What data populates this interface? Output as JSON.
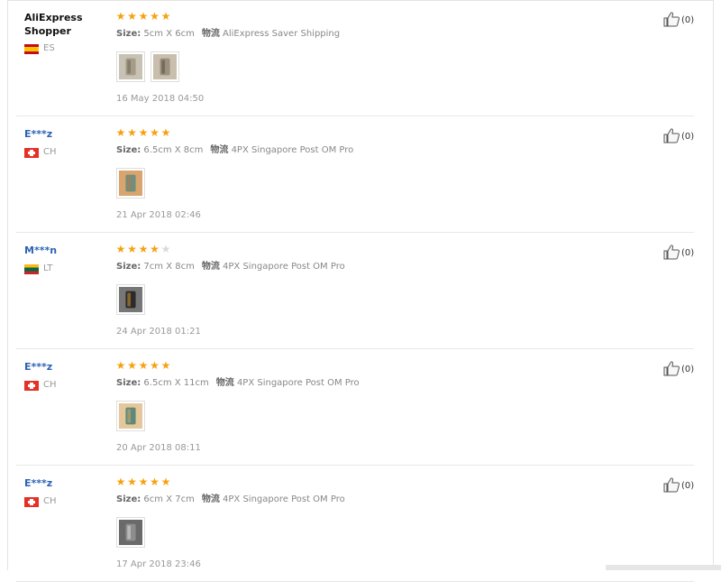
{
  "reviews": [
    {
      "buyer": "AliExpress Shopper",
      "country_code": "ES",
      "rating": 5,
      "size_label": "Size:",
      "size_value": "5cm X 6cm",
      "logistics_label": "物流",
      "logistics_value": "AliExpress Saver Shipping",
      "photo_count": 2,
      "date": "16 May 2018 04:50",
      "helpful_count": "(0)"
    },
    {
      "buyer": "E***z",
      "country_code": "CH",
      "rating": 5,
      "size_label": "Size:",
      "size_value": "6.5cm X 8cm",
      "logistics_label": "物流",
      "logistics_value": "4PX Singapore Post OM Pro",
      "photo_count": 1,
      "date": "21 Apr 2018 02:46",
      "helpful_count": "(0)"
    },
    {
      "buyer": "M***n",
      "country_code": "LT",
      "rating": 4,
      "size_label": "Size:",
      "size_value": "7cm X 8cm",
      "logistics_label": "物流",
      "logistics_value": "4PX Singapore Post OM Pro",
      "photo_count": 1,
      "date": "24 Apr 2018 01:21",
      "helpful_count": "(0)"
    },
    {
      "buyer": "E***z",
      "country_code": "CH",
      "rating": 5,
      "size_label": "Size:",
      "size_value": "6.5cm X 11cm",
      "logistics_label": "物流",
      "logistics_value": "4PX Singapore Post OM Pro",
      "photo_count": 1,
      "date": "20 Apr 2018 08:11",
      "helpful_count": "(0)"
    },
    {
      "buyer": "E***z",
      "country_code": "CH",
      "rating": 5,
      "size_label": "Size:",
      "size_value": "6cm X 7cm",
      "logistics_label": "物流",
      "logistics_value": "4PX Singapore Post OM Pro",
      "photo_count": 1,
      "date": "17 Apr 2018 23:46",
      "helpful_count": "(0)"
    }
  ],
  "icons": {
    "star": "star-icon",
    "helpful": "thumbs-up-icon",
    "flag": "country-flag-icon"
  },
  "colors": {
    "star_filled": "#f5a110",
    "star_empty": "#d9d9d9",
    "masked_name": "#2b63b6"
  }
}
